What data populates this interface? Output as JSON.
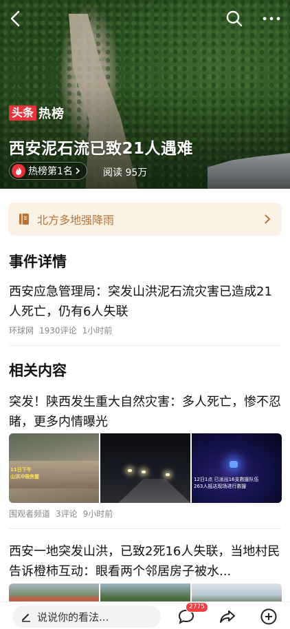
{
  "hero": {
    "brand_red": "头条",
    "brand_white": "热榜",
    "title": "西安泥石流已致21人遇难",
    "rank_label": "热榜第1名",
    "reads": "阅读 95万"
  },
  "topic": {
    "label": "北方多地强降雨"
  },
  "event": {
    "heading": "事件详情",
    "article": {
      "title": "西安应急管理局：突发山洪泥石流灾害已造成21人死亡，仍有6人失联",
      "source": "环球网",
      "comments": "1930评论",
      "time": "1小时前"
    }
  },
  "related": {
    "heading": "相关内容",
    "items": [
      {
        "title": "突发！陕西发生重大自然灾害：多人死亡，惨不忍睹，更多内情曝光",
        "thumb1_caption_a": "11日下午",
        "thumb1_caption_b": "山洪冲毁房屋",
        "thumb3_caption_a": "12日1点 已派出16支救援队伍",
        "thumb3_caption_b": "263人抵达现场进行救援",
        "source": "围观者频道",
        "comments": "3评论",
        "time": "9小时前"
      },
      {
        "title": "西安一地突发山洪，已致2死16人失联，当地村民告诉橙柿互动：眼看两个邻居房子被水..."
      }
    ]
  },
  "bottom": {
    "comment_placeholder": "说说你的看法...",
    "comment_count": "2775"
  },
  "colors": {
    "brand_red": "#e8323c",
    "topic_bg": "#fbf1e4",
    "topic_text": "#b9743a",
    "badge": "#f04142"
  }
}
